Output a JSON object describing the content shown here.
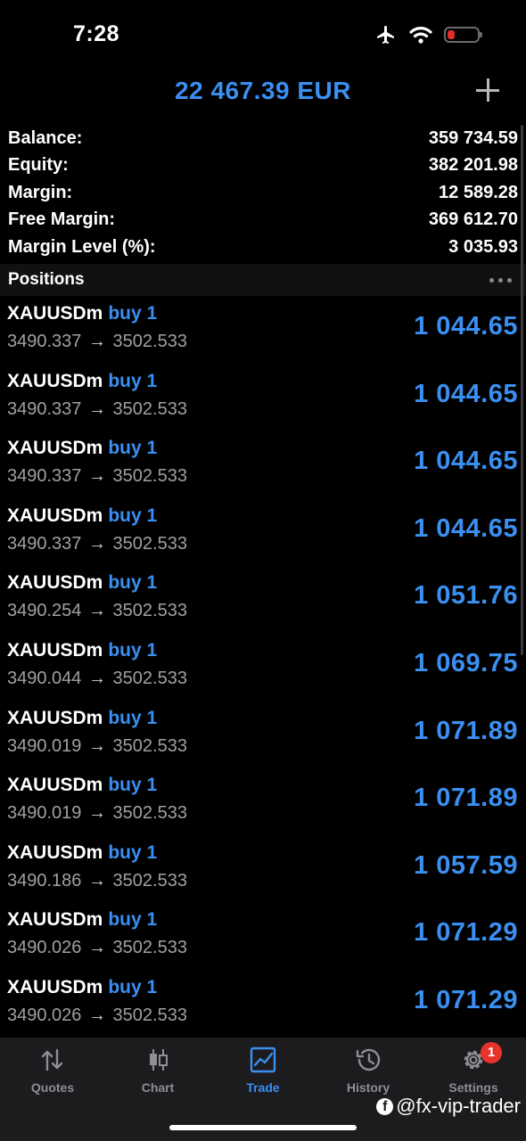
{
  "status": {
    "time": "7:28",
    "battery_level": 0.25
  },
  "header": {
    "balance": "22 467.39 EUR",
    "add_icon": "plus-icon"
  },
  "summary": [
    {
      "label": "Balance:",
      "value": "359 734.59"
    },
    {
      "label": "Equity:",
      "value": "382 201.98"
    },
    {
      "label": "Margin:",
      "value": "12 589.28"
    },
    {
      "label": "Free Margin:",
      "value": "369 612.70"
    },
    {
      "label": "Margin Level (%):",
      "value": "3 035.93"
    }
  ],
  "positions": {
    "title": "Positions",
    "arrow": "→",
    "items": [
      {
        "symbol": "XAUUSDm",
        "type": "buy 1",
        "open": "3490.337",
        "current": "3502.533",
        "profit": "1 044.65"
      },
      {
        "symbol": "XAUUSDm",
        "type": "buy 1",
        "open": "3490.337",
        "current": "3502.533",
        "profit": "1 044.65"
      },
      {
        "symbol": "XAUUSDm",
        "type": "buy 1",
        "open": "3490.337",
        "current": "3502.533",
        "profit": "1 044.65"
      },
      {
        "symbol": "XAUUSDm",
        "type": "buy 1",
        "open": "3490.337",
        "current": "3502.533",
        "profit": "1 044.65"
      },
      {
        "symbol": "XAUUSDm",
        "type": "buy 1",
        "open": "3490.254",
        "current": "3502.533",
        "profit": "1 051.76"
      },
      {
        "symbol": "XAUUSDm",
        "type": "buy 1",
        "open": "3490.044",
        "current": "3502.533",
        "profit": "1 069.75"
      },
      {
        "symbol": "XAUUSDm",
        "type": "buy 1",
        "open": "3490.019",
        "current": "3502.533",
        "profit": "1 071.89"
      },
      {
        "symbol": "XAUUSDm",
        "type": "buy 1",
        "open": "3490.019",
        "current": "3502.533",
        "profit": "1 071.89"
      },
      {
        "symbol": "XAUUSDm",
        "type": "buy 1",
        "open": "3490.186",
        "current": "3502.533",
        "profit": "1 057.59"
      },
      {
        "symbol": "XAUUSDm",
        "type": "buy 1",
        "open": "3490.026",
        "current": "3502.533",
        "profit": "1 071.29"
      },
      {
        "symbol": "XAUUSDm",
        "type": "buy 1",
        "open": "3490.026",
        "current": "3502.533",
        "profit": "1 071.29"
      }
    ]
  },
  "tabs": [
    {
      "label": "Quotes",
      "icon": "quotes-arrows-icon",
      "active": false
    },
    {
      "label": "Chart",
      "icon": "candlestick-icon",
      "active": false
    },
    {
      "label": "Trade",
      "icon": "trade-chart-icon",
      "active": true
    },
    {
      "label": "History",
      "icon": "history-clock-icon",
      "active": false
    },
    {
      "label": "Settings",
      "icon": "gear-icon",
      "active": false,
      "badge": "1"
    }
  ],
  "watermark": "@fx-vip-trader",
  "colors": {
    "accent": "#3b8ff0",
    "badge": "#e8332c",
    "background": "#000000"
  }
}
